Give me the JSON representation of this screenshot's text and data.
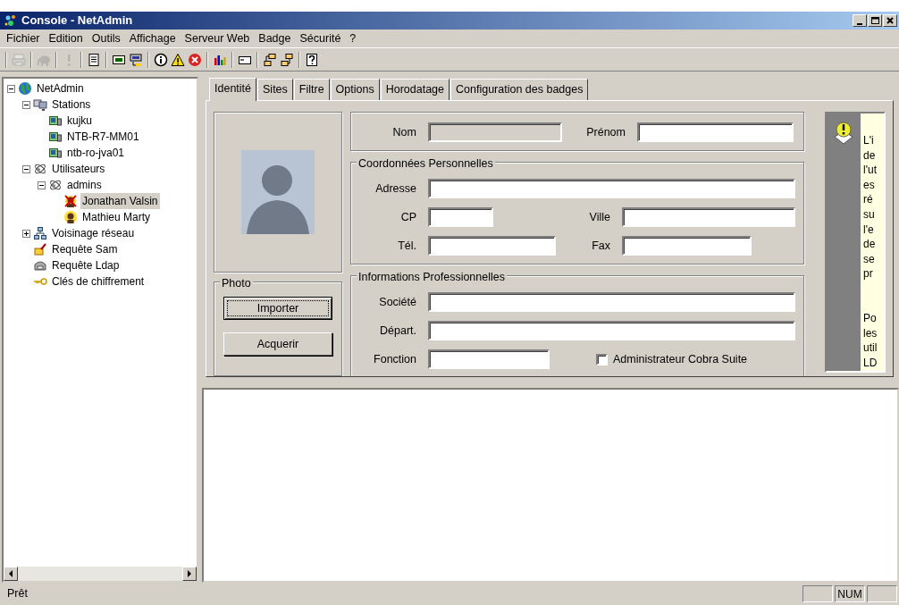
{
  "window": {
    "title": "Console - NetAdmin"
  },
  "menu": [
    {
      "label": "Fichier"
    },
    {
      "label": "Edition"
    },
    {
      "label": "Outils"
    },
    {
      "label": "Affichage"
    },
    {
      "label": "Serveur Web"
    },
    {
      "label": "Badge"
    },
    {
      "label": "Sécurité"
    },
    {
      "label": "?"
    }
  ],
  "toolbar": [
    [
      {
        "kind": "print",
        "disabled": true
      }
    ],
    [
      {
        "kind": "elephant",
        "disabled": true
      }
    ],
    [
      {
        "kind": "exclaim",
        "disabled": true
      }
    ],
    [
      {
        "kind": "document",
        "disabled": false
      }
    ],
    [
      {
        "kind": "screen",
        "disabled": false
      },
      {
        "kind": "terminal",
        "disabled": false
      }
    ],
    [
      {
        "kind": "info",
        "disabled": false
      },
      {
        "kind": "warning",
        "disabled": false
      },
      {
        "kind": "error",
        "disabled": false
      }
    ],
    [
      {
        "kind": "chart",
        "disabled": false
      }
    ],
    [
      {
        "kind": "card",
        "disabled": false
      }
    ],
    [
      {
        "kind": "node-add",
        "disabled": false
      },
      {
        "kind": "node-remove",
        "disabled": false
      }
    ],
    [
      {
        "kind": "help",
        "disabled": false
      }
    ]
  ],
  "tree": [
    {
      "label": "NetAdmin",
      "kind": "globe",
      "expanded": true,
      "selected": false,
      "children": [
        {
          "label": "Stations",
          "kind": "computers",
          "expanded": true,
          "selected": false,
          "children": [
            {
              "label": "kujku",
              "kind": "workstation",
              "selected": false
            },
            {
              "label": "NTB-R7-MM01",
              "kind": "workstation",
              "selected": false
            },
            {
              "label": "ntb-ro-jva01",
              "kind": "workstation",
              "selected": false
            }
          ]
        },
        {
          "label": "Utilisateurs",
          "kind": "group",
          "expanded": true,
          "selected": false,
          "children": [
            {
              "label": "admins",
              "kind": "group",
              "expanded": true,
              "selected": false,
              "children": [
                {
                  "label": "Jonathan Valsin",
                  "kind": "disabled-user",
                  "selected": true
                },
                {
                  "label": "Mathieu Marty",
                  "kind": "user",
                  "selected": false
                }
              ]
            }
          ]
        },
        {
          "label": "Voisinage réseau",
          "kind": "network",
          "expanded": false,
          "selected": false
        },
        {
          "label": "Requête Sam",
          "kind": "query",
          "selected": false
        },
        {
          "label": "Requête Ldap",
          "kind": "server",
          "selected": false
        },
        {
          "label": "Clés de chiffrement",
          "kind": "key",
          "selected": false
        }
      ]
    }
  ],
  "tabs": [
    {
      "label": "Identité",
      "selected": true
    },
    {
      "label": "Sites",
      "selected": false
    },
    {
      "label": "Filtre",
      "selected": false
    },
    {
      "label": "Options",
      "selected": false
    },
    {
      "label": "Horodatage",
      "selected": false
    },
    {
      "label": "Configuration des badges",
      "selected": false
    }
  ],
  "photo_group": {
    "title": "Photo",
    "buttons": [
      {
        "label": "Importer",
        "focused": true
      },
      {
        "label": "Acquerir",
        "focused": false
      }
    ]
  },
  "groups": [
    {
      "rows": [
        [
          {
            "label": "Nom",
            "disabled": true
          },
          {
            "label": "Prénom",
            "disabled": false
          }
        ]
      ]
    },
    {
      "title": "Coordonnées Personnelles",
      "rows": [
        [
          {
            "label": "Adresse",
            "disabled": false
          }
        ],
        [
          {
            "label": "CP",
            "disabled": false
          },
          {
            "label": "Ville",
            "disabled": false
          }
        ],
        [
          {
            "label": "Tél.",
            "disabled": false
          },
          {
            "label": "Fax",
            "disabled": false
          }
        ]
      ]
    },
    {
      "title": "Informations Professionnelles",
      "rows": [
        [
          {
            "label": "Société",
            "disabled": false
          }
        ],
        [
          {
            "label": "Départ.",
            "disabled": false
          }
        ],
        [
          {
            "label": "Fonction",
            "disabled": false
          }
        ]
      ],
      "checkbox": {
        "label": "Administrateur Cobra Suite",
        "checked": false
      }
    }
  ],
  "help": {
    "paragraphs": [
      [
        "L'i",
        "de",
        "l'ut",
        "es",
        "ré",
        "su",
        "l'e",
        "de",
        "se",
        "pr"
      ],
      [
        "Po",
        "les",
        "util",
        "LD"
      ]
    ]
  },
  "status_bar": {
    "text": "Prêt",
    "indicators": [
      "NUM"
    ]
  }
}
